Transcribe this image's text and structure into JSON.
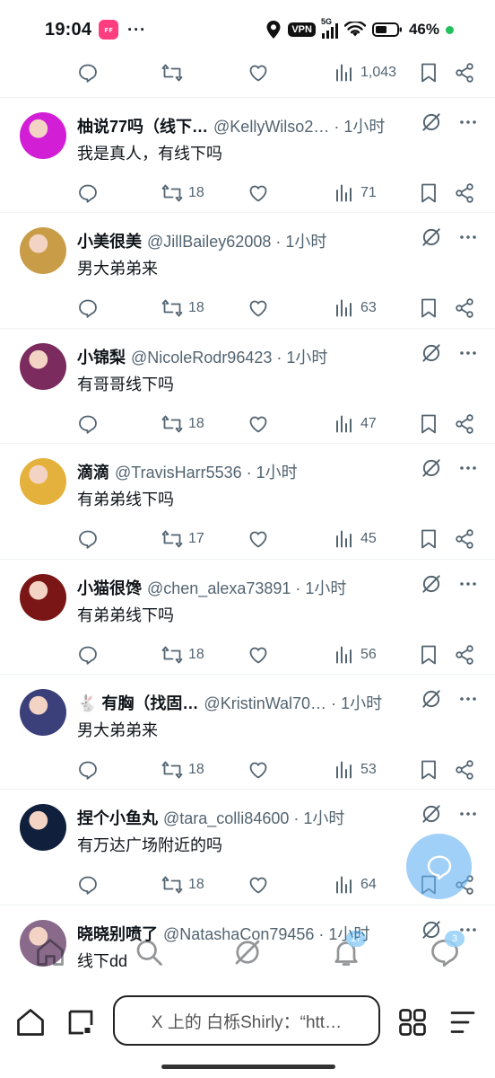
{
  "status_bar": {
    "time": "19:04",
    "app_badge": "ꜰꜰ",
    "dots": "···",
    "vpn": "VPN",
    "network": "5G",
    "battery": "46%"
  },
  "first_actions": {
    "views": "1,043"
  },
  "posts": [
    {
      "name": "柚说77吗（线下…",
      "handle": "@KellyWilso2…",
      "time": "1小时",
      "text": "我是真人，有线下吗",
      "retweets": "18",
      "views": "71",
      "avatar_color": "#d21fd6"
    },
    {
      "name": "小美很美",
      "handle": "@JillBailey62008",
      "time": "1小时",
      "text": "男大弟弟来",
      "retweets": "18",
      "views": "63",
      "avatar_color": "#c99d48"
    },
    {
      "name": "小锦梨",
      "handle": "@NicoleRodr96423",
      "time": "1小时",
      "text": "有哥哥线下吗",
      "retweets": "18",
      "views": "47",
      "avatar_color": "#7b2b5e"
    },
    {
      "name": "滴滴",
      "handle": "@TravisHarr5536",
      "time": "1小时",
      "text": "有弟弟线下吗",
      "retweets": "17",
      "views": "45",
      "avatar_color": "#e4b23c"
    },
    {
      "name": "小猫很馋",
      "handle": "@chen_alexa73891",
      "time": "1小时",
      "text": "有弟弟线下吗",
      "retweets": "18",
      "views": "56",
      "avatar_color": "#7a1616"
    },
    {
      "name": "🐇 有胸（找固…",
      "handle": "@KristinWal70…",
      "time": "1小时",
      "text": "男大弟弟来",
      "retweets": "18",
      "views": "53",
      "avatar_color": "#3b3f7a"
    },
    {
      "name": "捏个小鱼丸",
      "handle": "@tara_colli84600",
      "time": "1小时",
      "text": "有万达广场附近的吗",
      "retweets": "18",
      "views": "64",
      "avatar_color": "#101f3b"
    },
    {
      "name": "晓晓别喷了",
      "handle": "@NatashaCon79456",
      "time": "1小时",
      "text": "线下dd",
      "retweets": "",
      "views": "",
      "avatar_color": "#8a6a8a"
    }
  ],
  "tabbar": {
    "notifications_badge": "17",
    "messages_badge": "3"
  },
  "browser": {
    "url_text": "X 上的 白栎Shirly：“htt…"
  }
}
